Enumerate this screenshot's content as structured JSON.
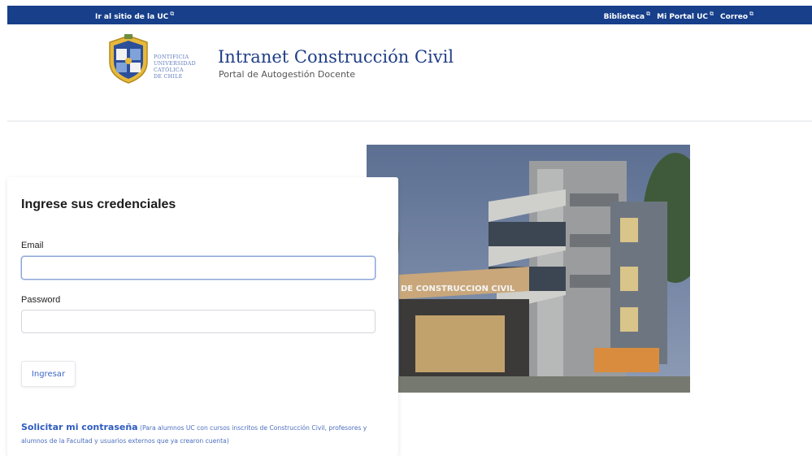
{
  "topbar": {
    "left_link": "Ir al sitio de la UC",
    "right_links": [
      "Biblioteca",
      "Mi Portal UC",
      "Correo"
    ],
    "bg_color": "#173f8a"
  },
  "header": {
    "logo_lines": [
      "PONTIFICIA",
      "UNIVERSIDAD",
      "CATÓLICA",
      "DE CHILE"
    ],
    "title": "Intranet Construcción Civil",
    "subtitle": "Portal de Autogestión Docente"
  },
  "login": {
    "heading": "Ingrese sus credenciales",
    "email_label": "Email",
    "email_value": "",
    "password_label": "Password",
    "password_value": "",
    "submit_label": "Ingresar",
    "request_link": "Solicitar mi contraseña",
    "request_note": "(Para alumnos UC con cursos inscritos de Construcción Civil, profesores y alumnos de la Facultad y usuarios externos que ya crearon cuenta)"
  },
  "photo": {
    "sign_text": "DE CONSTRUCCION CIVIL"
  },
  "icons": {
    "external": "external-link-icon",
    "seal": "university-seal-icon"
  },
  "colors": {
    "accent": "#1f3d87",
    "link": "#2d5bbf"
  }
}
